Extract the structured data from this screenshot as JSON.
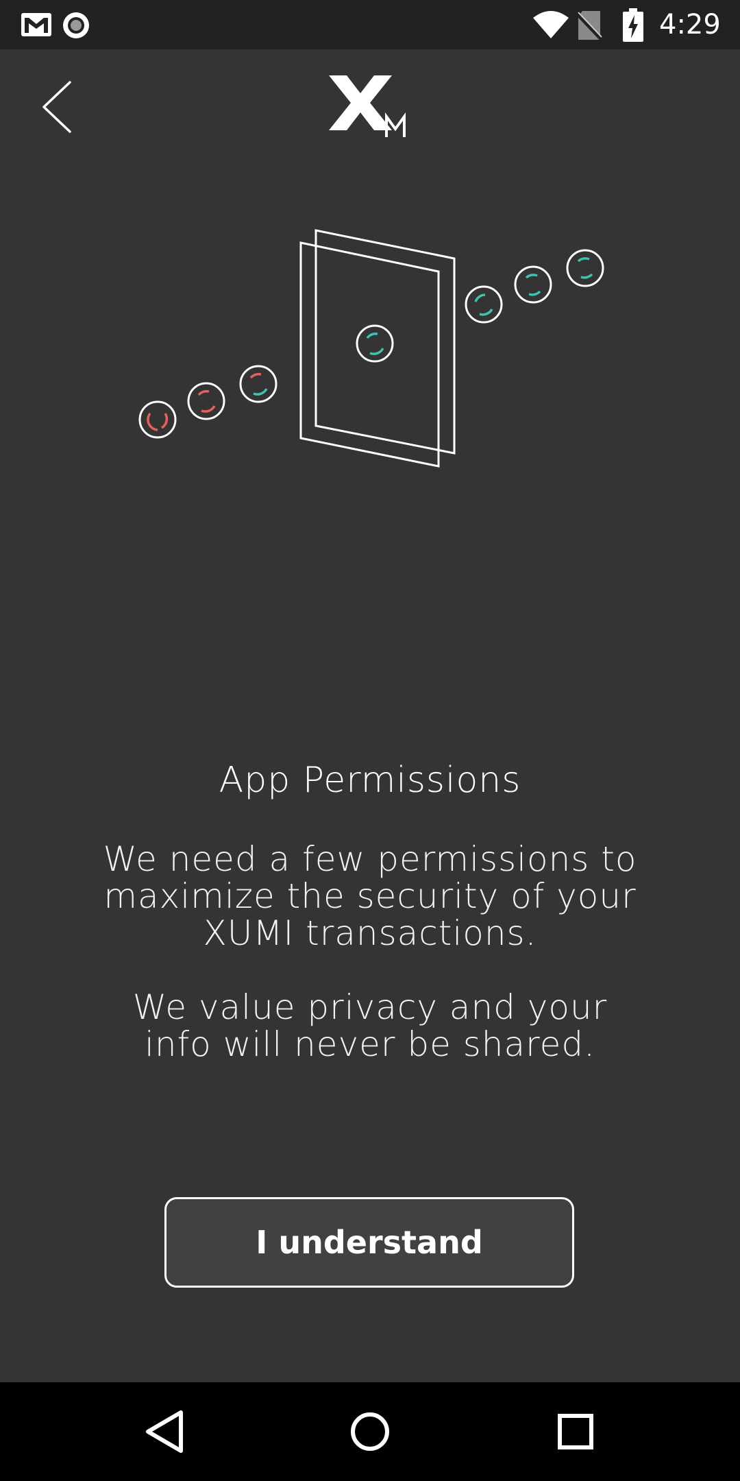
{
  "status_bar": {
    "time": "4:29",
    "icons": [
      "gmail-icon",
      "record-icon",
      "wifi-icon",
      "no-sim-icon",
      "battery-charging-icon"
    ]
  },
  "header": {
    "back_icon": "chevron-left-icon",
    "logo_letters": "XM"
  },
  "illustration": {
    "icon": "secure-transfer-illustration",
    "colors": {
      "stroke": "#ffffff",
      "red": "#e8605a",
      "teal": "#3fc2b3"
    }
  },
  "content": {
    "title": "App Permissions",
    "paragraph1": "We need a few permissions to maximize the security of your XUMI transactions.",
    "paragraph2": "We value privacy and your info will never be shared."
  },
  "actions": {
    "primary_label": "I understand"
  },
  "nav_bar": {
    "icons": [
      "back-triangle-icon",
      "home-circle-icon",
      "recents-square-icon"
    ]
  },
  "colors": {
    "background": "#343434",
    "status_bar": "#222222",
    "nav_bar": "#000000",
    "button_fill": "#414141",
    "text": "#ffffff"
  }
}
